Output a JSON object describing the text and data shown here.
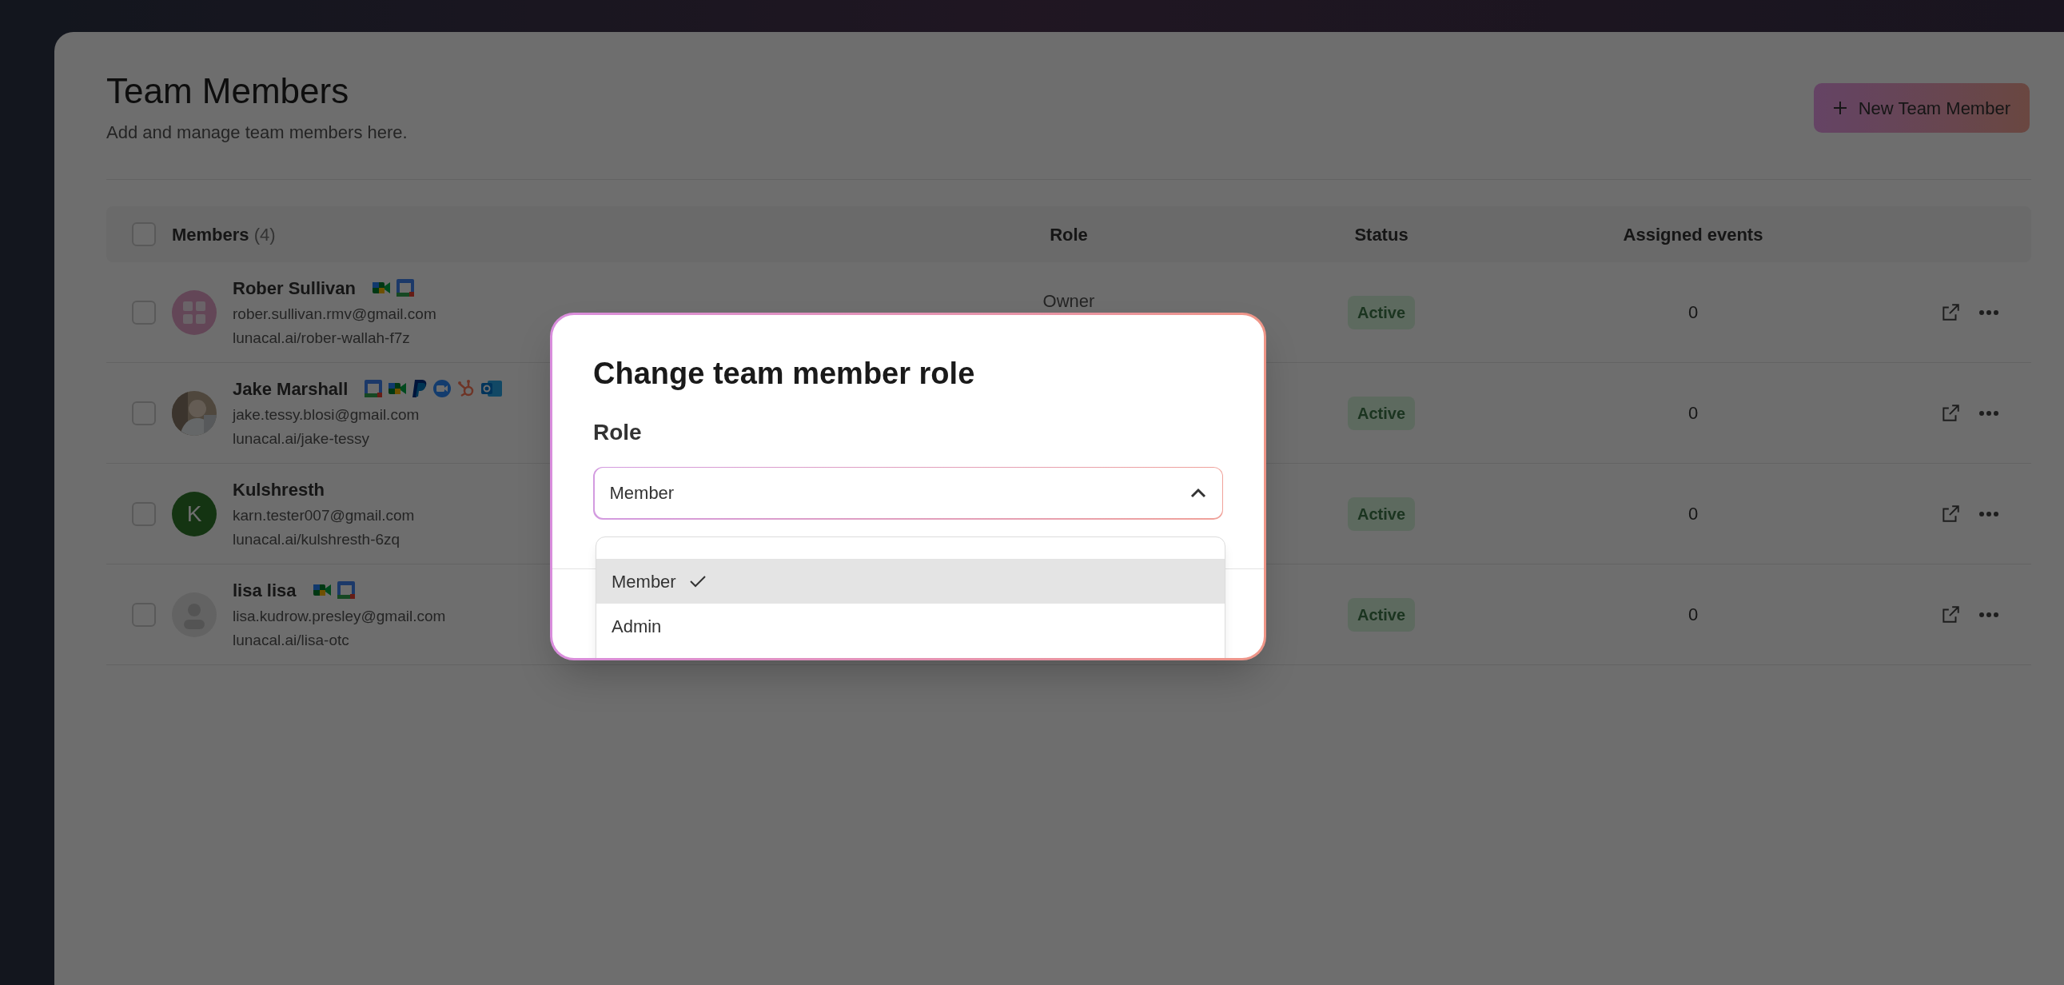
{
  "page": {
    "title": "Team Members",
    "subtitle": "Add and manage team members here.",
    "new_button": "New Team Member"
  },
  "table": {
    "select_all_checked": false,
    "columns": {
      "members": "Members",
      "members_count": "(4)",
      "role": "Role",
      "status": "Status",
      "assigned": "Assigned events"
    },
    "rows": [
      {
        "checked": false,
        "avatar": {
          "kind": "logo"
        },
        "name": "Rober Sullivan",
        "integrations": [
          {
            "kind": "meet"
          },
          {
            "kind": "calendar"
          }
        ],
        "email": "rober.sullivan.rmv@gmail.com",
        "link": "lunacal.ai/rober-wallah-f7z",
        "role": "Owner",
        "status": "Active",
        "assigned": "0"
      },
      {
        "checked": false,
        "name": "Jake Marshall",
        "integrations": [
          {
            "kind": "calendar"
          },
          {
            "kind": "meet"
          },
          {
            "kind": "paypal"
          },
          {
            "kind": "zoom"
          },
          {
            "kind": "hubspot"
          },
          {
            "kind": "outlook"
          }
        ],
        "email": "jake.tessy.blosi@gmail.com",
        "link": "lunacal.ai/jake-tessy",
        "status": "Active",
        "assigned": "0"
      },
      {
        "checked": false,
        "avatar": {
          "kind": "letter",
          "letter": "K"
        },
        "name": "Kulshresth",
        "integrations": [],
        "email": "karn.tester007@gmail.com",
        "link": "lunacal.ai/kulshresth-6zq",
        "status": "Active",
        "assigned": "0"
      },
      {
        "checked": false,
        "avatar": {
          "kind": "silhouette"
        },
        "name": "lisa lisa",
        "integrations": [
          {
            "kind": "meet"
          },
          {
            "kind": "calendar"
          }
        ],
        "email": "lisa.kudrow.presley@gmail.com",
        "link": "lunacal.ai/lisa-otc",
        "status": "Active",
        "assigned": "0"
      }
    ]
  },
  "dialog": {
    "title": "Change team member role",
    "field_label": "Role",
    "value": "Member",
    "expanded": true,
    "options": [
      {
        "label": "Member",
        "selected": true
      },
      {
        "label": "Admin",
        "selected": false
      }
    ]
  }
}
